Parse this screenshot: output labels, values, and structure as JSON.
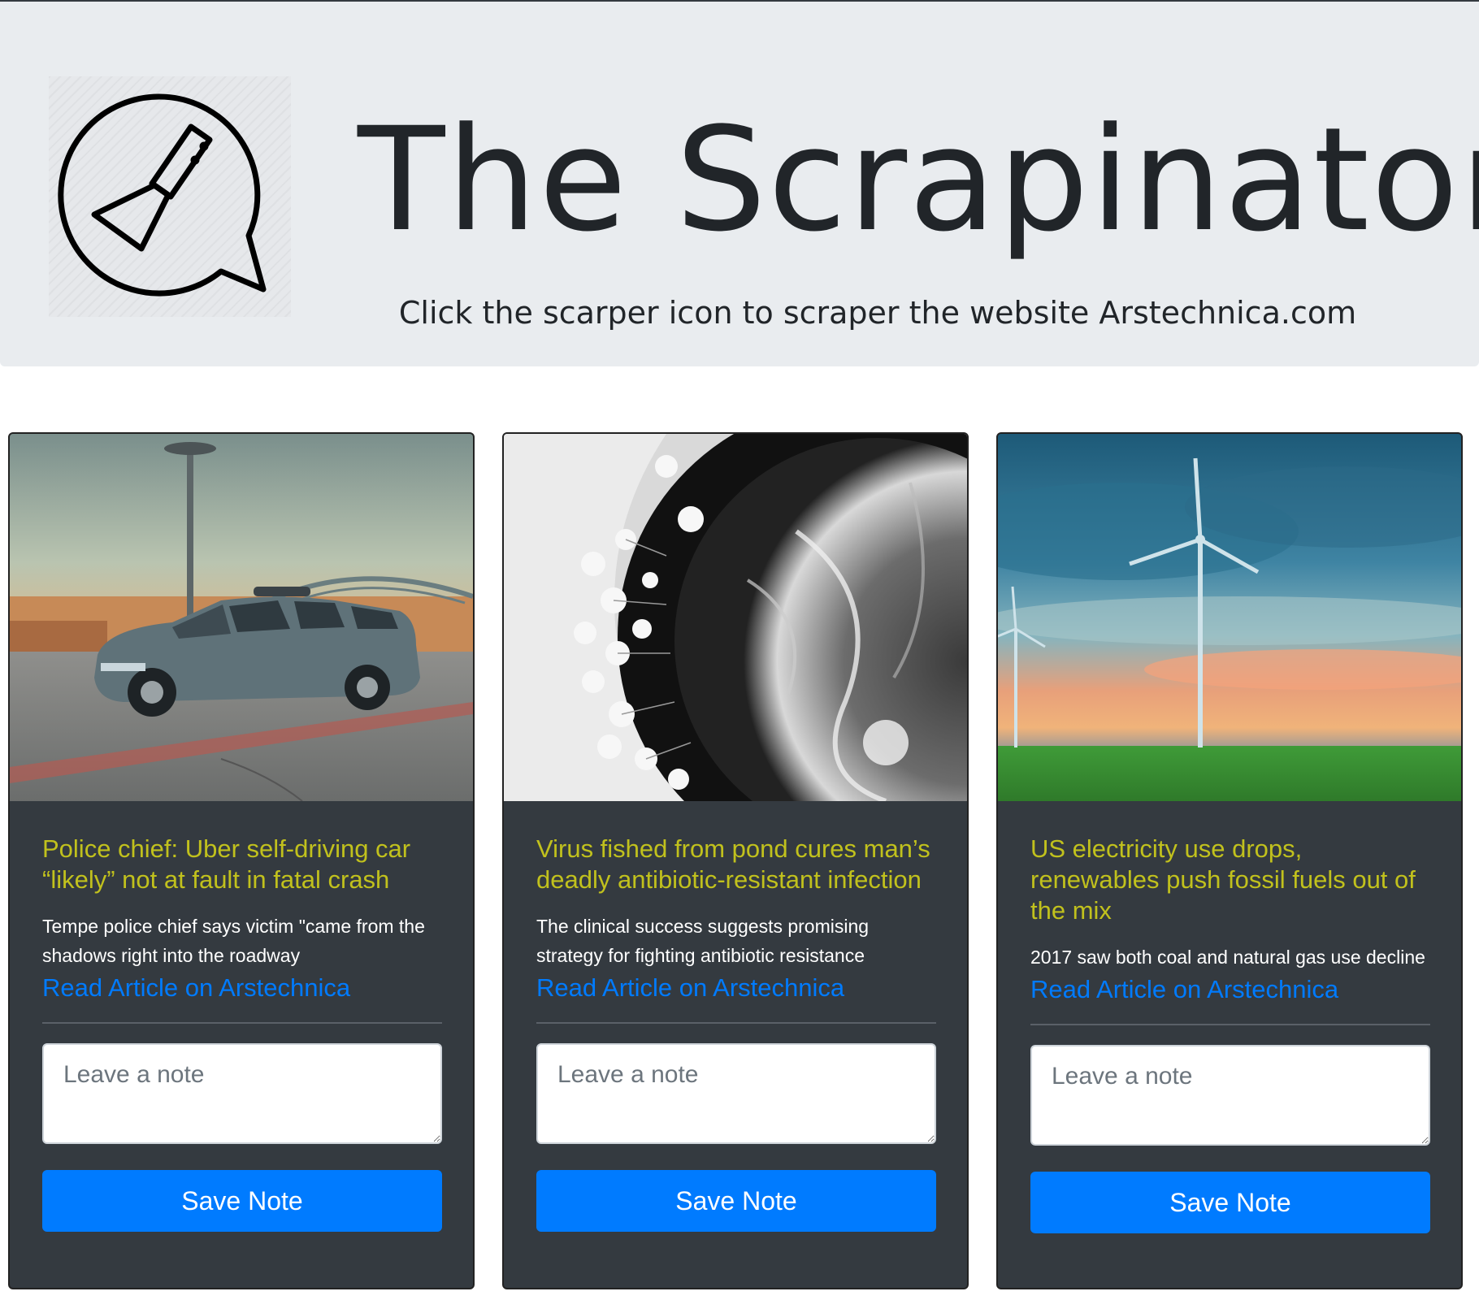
{
  "header": {
    "title": "The Scrapinator",
    "subtitle": "Click the scarper icon to scraper the website Arstechnica.com",
    "logo_icon": "scraper-speech-bubble-icon"
  },
  "articles": [
    {
      "title": "Police chief: Uber self-driving car “likely” not at fault in fatal crash",
      "summary": "Tempe police chief says victim \"came from the shadows right into the roadway",
      "link_label": "Read Article on Arstechnica",
      "note_placeholder": "Leave a note",
      "save_label": "Save Note",
      "image": "self-driving-car-photo"
    },
    {
      "title": "Virus fished from pond cures man’s deadly antibiotic-resistant infection",
      "summary": "The clinical success suggests promising strategy for fighting antibiotic resistance",
      "link_label": "Read Article on Arstechnica",
      "note_placeholder": "Leave a note",
      "save_label": "Save Note",
      "image": "bacteriophage-micrograph-photo"
    },
    {
      "title": "US electricity use drops, renewables push fossil fuels out of the mix",
      "summary": "2017 saw both coal and natural gas use decline",
      "link_label": "Read Article on Arstechnica",
      "note_placeholder": "Leave a note",
      "save_label": "Save Note",
      "image": "wind-turbines-photo"
    }
  ],
  "colors": {
    "jumbotron_bg": "#e9ecef",
    "card_bg": "#343a40",
    "title_accent": "#c1c11d",
    "link_blue": "#007bff",
    "button_blue": "#007bff"
  }
}
